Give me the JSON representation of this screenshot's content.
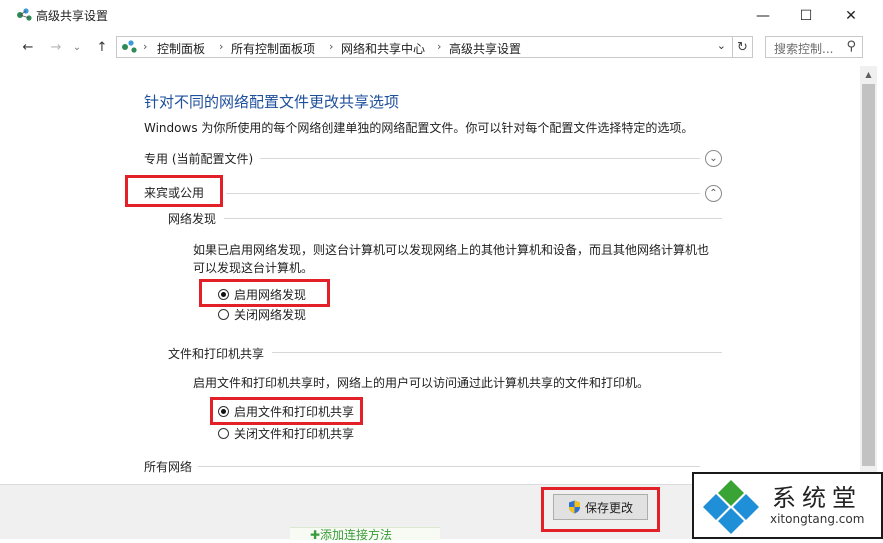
{
  "window": {
    "title": "高级共享设置",
    "minimize": "—",
    "maximize": "☐",
    "close": "✕"
  },
  "nav": {
    "back": "←",
    "forward": "→",
    "recent": "⌄",
    "up": "↑",
    "breadcrumbs": [
      "控制面板",
      "所有控制面板项",
      "网络和共享中心",
      "高级共享设置"
    ],
    "separator": "›",
    "dropdown": "⌄",
    "refresh": "↻",
    "search_placeholder": "搜索控制...",
    "search_icon": "⚲"
  },
  "content": {
    "title": "针对不同的网络配置文件更改共享选项",
    "description": "Windows 为你所使用的每个网络创建单独的网络配置文件。你可以针对每个配置文件选择特定的选项。",
    "profiles": {
      "private_label": "专用 (当前配置文件)",
      "guest_label": "来宾或公用",
      "all_label": "所有网络"
    },
    "network_discovery": {
      "heading": "网络发现",
      "paragraph_line1": "如果已启用网络发现，则这台计算机可以发现网络上的其他计算机和设备，而且其他网络计算机也",
      "paragraph_line2": "可以发现这台计算机。",
      "option_on": "启用网络发现",
      "option_off": "关闭网络发现",
      "selected": "on"
    },
    "file_printer_sharing": {
      "heading": "文件和打印机共享",
      "paragraph": "启用文件和打印机共享时，网络上的用户可以访问通过此计算机共享的文件和打印机。",
      "option_on": "启用文件和打印机共享",
      "option_off": "关闭文件和打印机共享",
      "selected": "on"
    },
    "chevron_down": "⌄",
    "chevron_up": "⌃"
  },
  "scrollbar": {
    "up": "▲",
    "down": "▼"
  },
  "footer": {
    "save_label": "保存更改",
    "below_text": "✚添加连接方法"
  },
  "watermark": {
    "name": "系统堂",
    "url": "xitongtang.com"
  },
  "colors": {
    "accent_title": "#1e4f9c",
    "highlight_red": "#e32028"
  }
}
